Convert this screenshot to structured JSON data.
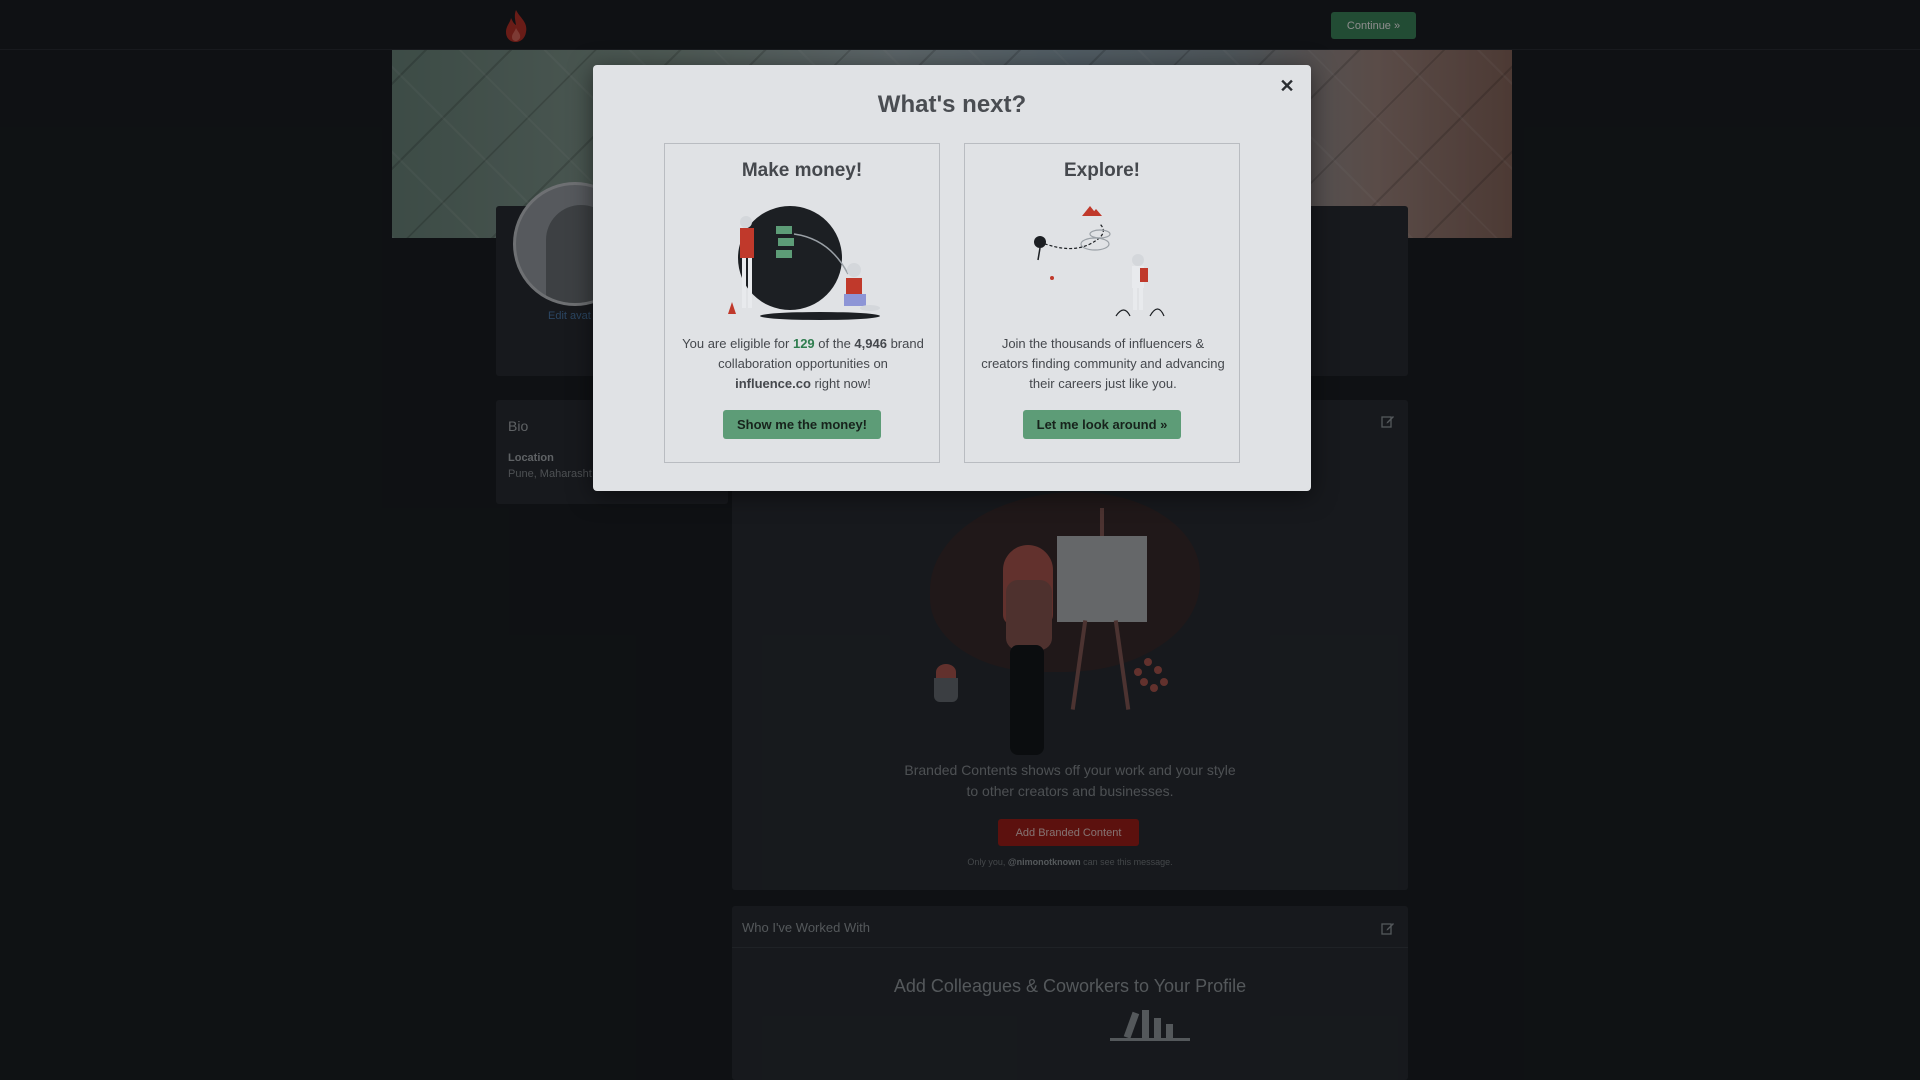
{
  "topbar": {
    "continue_label": "Continue »"
  },
  "profile": {
    "edit_avatar_label": "Edit avat"
  },
  "bio": {
    "title": "Bio",
    "location_label": "Location",
    "location_value": "Pune, Maharasht"
  },
  "branded": {
    "description": "Branded Contents shows off your work and your style to other creators and businesses.",
    "add_button_label": "Add Branded Content",
    "only_you_prefix": "Only you, ",
    "only_you_handle": "@nimonotknown",
    "only_you_suffix": " can see this message."
  },
  "who": {
    "title": "Who I've Worked With",
    "heading": "Add Colleagues & Coworkers to Your Profile"
  },
  "modal": {
    "title": "What's next?",
    "close_symbol": "✕",
    "money": {
      "title": "Make money!",
      "text_1": "You are eligible for ",
      "eligible_count": "129",
      "text_2": " of the ",
      "total_count": "4,946",
      "text_3": " brand collaboration opportunities on ",
      "site": "influence.co",
      "text_4": " right now!",
      "button_label": "Show me the money!"
    },
    "explore": {
      "title": "Explore!",
      "text": "Join the thousands of influencers & creators finding community and advancing their careers just like you.",
      "button_label": "Let me look around »"
    }
  },
  "colors": {
    "accent_green": "#5d9c77",
    "brand_red": "#a8201a",
    "modal_bg": "#e0e2e5"
  },
  "icons": {
    "logo": "flame-icon",
    "edit": "edit-icon",
    "close": "close-icon"
  }
}
